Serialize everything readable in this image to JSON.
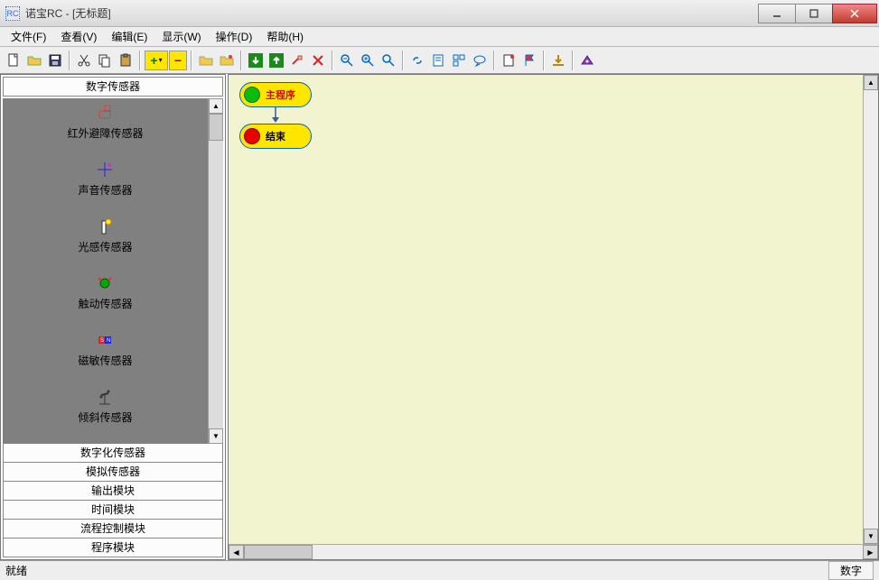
{
  "title": "诺宝RC - [无标题]",
  "menu": {
    "file": "文件(F)",
    "view": "查看(V)",
    "edit": "编辑(E)",
    "display": "显示(W)",
    "operate": "操作(D)",
    "help": "帮助(H)"
  },
  "toolbar": {
    "new_icon": "new-file-icon",
    "open_icon": "open-folder-icon",
    "save_icon": "save-icon",
    "cut_icon": "cut-icon",
    "copy_icon": "copy-icon",
    "paste_icon": "paste-icon",
    "plus": "+",
    "minus": "−"
  },
  "sidebar": {
    "header": "数字传感器",
    "items": [
      {
        "label": "红外避障传感器",
        "icon": "ir-sensor-icon"
      },
      {
        "label": "声音传感器",
        "icon": "sound-sensor-icon"
      },
      {
        "label": "光感传感器",
        "icon": "light-sensor-icon"
      },
      {
        "label": "触动传感器",
        "icon": "touch-sensor-icon"
      },
      {
        "label": "磁敏传感器",
        "icon": "magnet-sensor-icon"
      },
      {
        "label": "倾斜传感器",
        "icon": "tilt-sensor-icon"
      }
    ],
    "categories": [
      "数字化传感器",
      "模拟传感器",
      "输出模块",
      "时间模块",
      "流程控制模块",
      "程序模块"
    ]
  },
  "canvas": {
    "start_label": "主程序",
    "end_label": "结束"
  },
  "status": {
    "left": "就绪",
    "right": "数字"
  }
}
